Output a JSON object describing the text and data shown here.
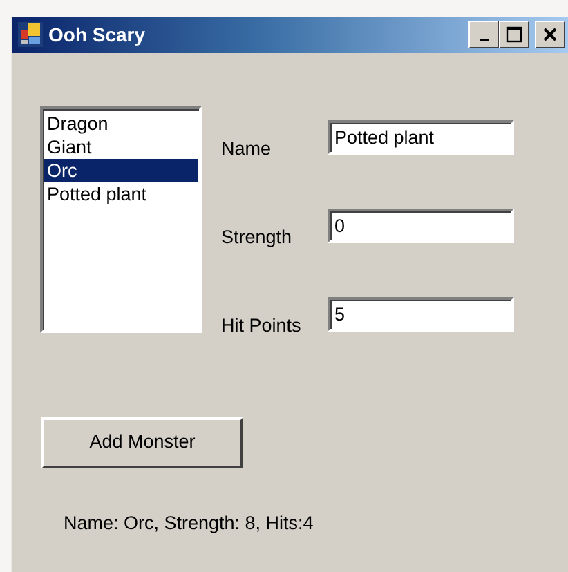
{
  "window": {
    "title": "Ooh Scary"
  },
  "monster_list": [
    {
      "label": "Dragon",
      "selected": false
    },
    {
      "label": "Giant",
      "selected": false
    },
    {
      "label": "Orc",
      "selected": true
    },
    {
      "label": "Potted plant",
      "selected": false
    }
  ],
  "fields": [
    {
      "label": "Name",
      "value": "Potted plant"
    },
    {
      "label": "Strength",
      "value": "0"
    },
    {
      "label": "Hit Points",
      "value": "5"
    }
  ],
  "add_button": "Add Monster",
  "status": "Name: Orc, Strength: 8, Hits:4"
}
